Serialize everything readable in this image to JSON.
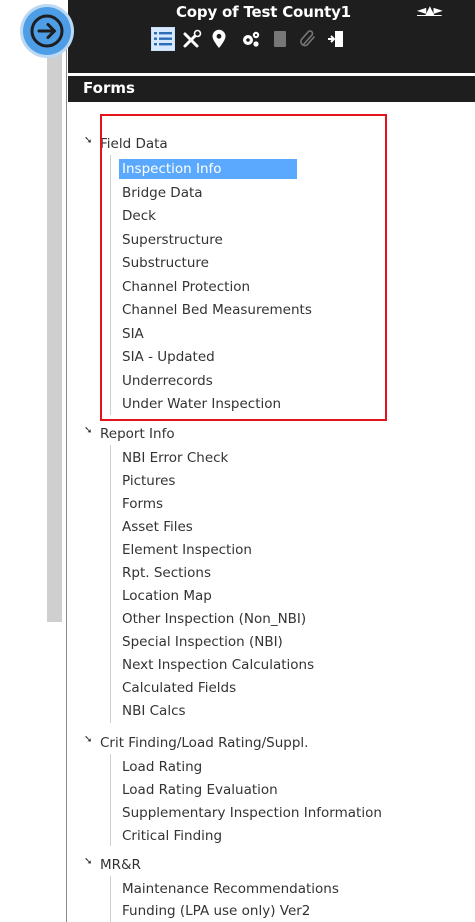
{
  "header": {
    "title": "Copy of Test County1",
    "nav_arrows": "◄▲►",
    "forms_title": "Forms"
  },
  "toolbar": {
    "icons": [
      "list-icon",
      "tools-icon",
      "location-pin-icon",
      "gears-icon",
      "document-icon",
      "paperclip-icon",
      "exit-door-icon"
    ]
  },
  "tree": {
    "groups": [
      {
        "label": "Field Data",
        "items": [
          "Inspection Info",
          "Bridge Data",
          "Deck",
          "Superstructure",
          "Substructure",
          "Channel Protection",
          "Channel Bed Measurements",
          "SIA",
          "SIA - Updated",
          "Underrecords",
          "Under Water Inspection"
        ],
        "selected": "Inspection Info"
      },
      {
        "label": "Report Info",
        "items": [
          "NBI Error Check",
          "Pictures",
          "Forms",
          "Asset Files",
          "Element Inspection",
          "Rpt. Sections",
          "Location Map",
          "Other Inspection (Non_NBI)",
          "Special Inspection (NBI)",
          "Next Inspection Calculations",
          "Calculated Fields",
          "NBI Calcs"
        ]
      },
      {
        "label": "Crit Finding/Load Rating/Suppl.",
        "items": [
          "Load Rating",
          "Load Rating Evaluation",
          "Supplementary Inspection Information",
          "Critical Finding"
        ]
      },
      {
        "label": "MR&R",
        "items": [
          "Maintenance Recommendations",
          "Funding (LPA use only) Ver2"
        ]
      }
    ]
  },
  "colors": {
    "header_bg": "#1e1e1e",
    "selection": "#5aa9ff",
    "highlight_box": "#e3141b",
    "nav_button": "#4d9ee6"
  }
}
